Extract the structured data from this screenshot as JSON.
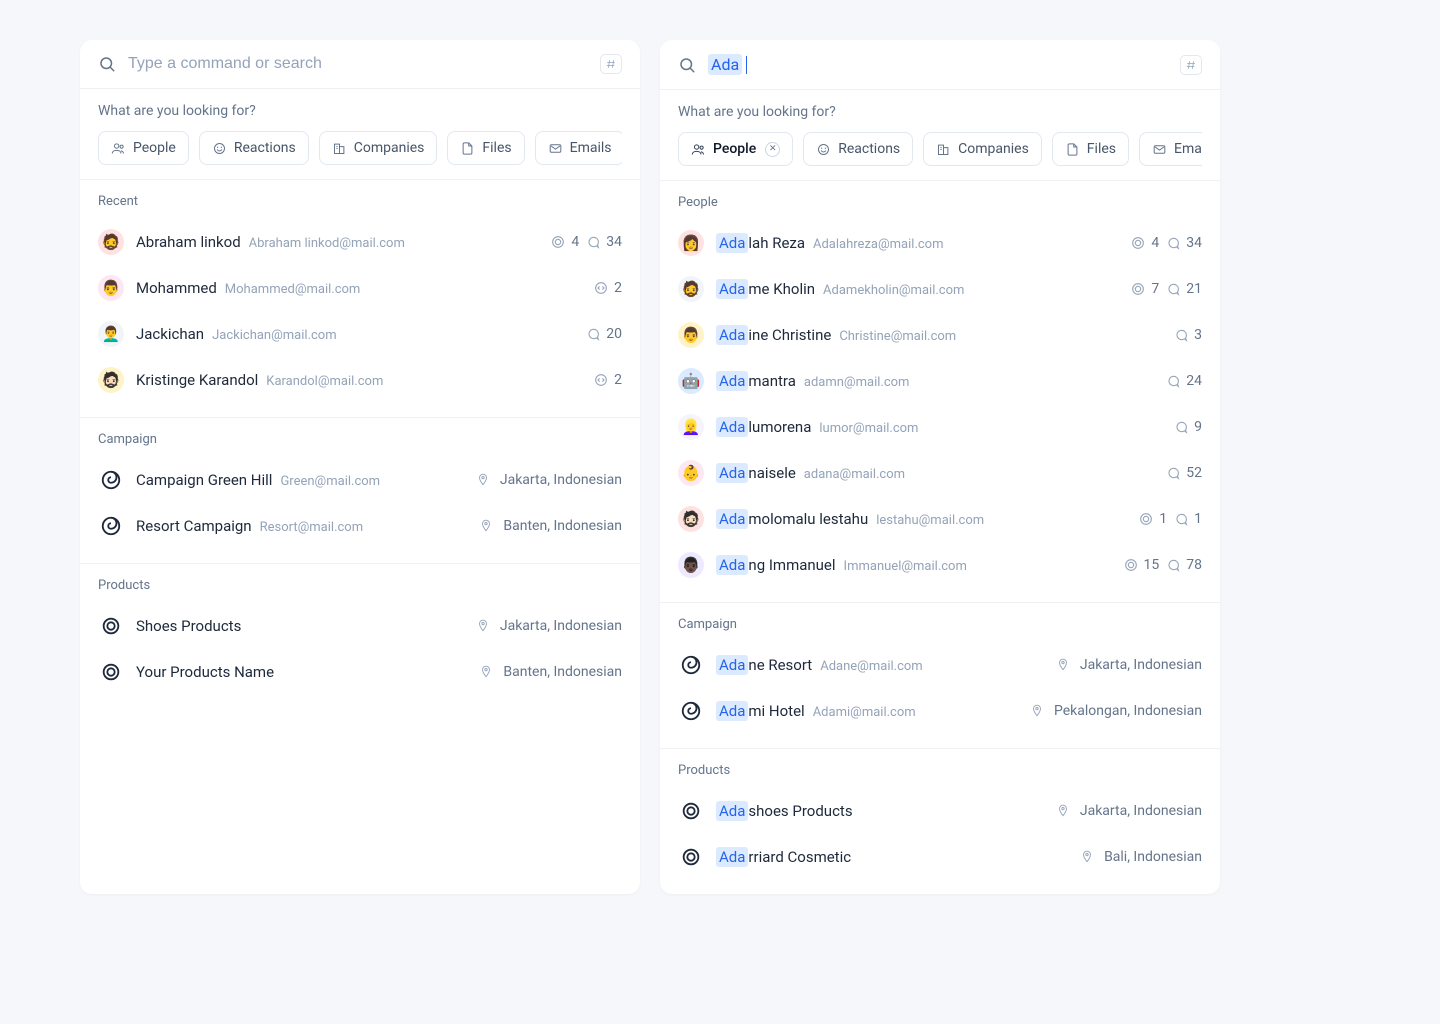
{
  "left": {
    "search": {
      "placeholder": "Type a command or search"
    },
    "filterLabel": "What are you looking for?",
    "chips": [
      {
        "label": "People",
        "icon": "people"
      },
      {
        "label": "Reactions",
        "icon": "reactions"
      },
      {
        "label": "Companies",
        "icon": "companies"
      },
      {
        "label": "Files",
        "icon": "files"
      },
      {
        "label": "Emails",
        "icon": "emails"
      }
    ],
    "sections": {
      "recent": {
        "title": "Recent",
        "rows": [
          {
            "name": "Abraham linkod",
            "email": "Abraham linkod@mail.com",
            "avatar": "🧔",
            "bg": "#FEE2E2",
            "stats": {
              "target": 4,
              "chat": 34
            }
          },
          {
            "name": "Mohammed",
            "email": "Mohammed@mail.com",
            "avatar": "👨",
            "bg": "#FCE7F3",
            "stats": {
              "code": 2
            }
          },
          {
            "name": "Jackichan",
            "email": "Jackichan@mail.com",
            "avatar": "👨‍🦱",
            "bg": "#F1F5F9",
            "stats": {
              "chat": 20
            }
          },
          {
            "name": "Kristinge Karandol",
            "email": "Karandol@mail.com",
            "avatar": "🧔🏻",
            "bg": "#FEF3C7",
            "stats": {
              "code": 2
            }
          }
        ]
      },
      "campaign": {
        "title": "Campaign",
        "rows": [
          {
            "name": "Campaign Green Hill",
            "email": "Green@mail.com",
            "location": "Jakarta, Indonesian"
          },
          {
            "name": "Resort Campaign",
            "email": "Resort@mail.com",
            "location": "Banten, Indonesian"
          }
        ]
      },
      "products": {
        "title": "Products",
        "rows": [
          {
            "name": "Shoes Products",
            "location": "Jakarta, Indonesian"
          },
          {
            "name": "Your Products Name",
            "location": "Banten, Indonesian"
          }
        ]
      }
    }
  },
  "right": {
    "search": {
      "query": "Ada"
    },
    "filterLabel": "What are you looking for?",
    "chips": [
      {
        "label": "People",
        "icon": "people",
        "active": true
      },
      {
        "label": "Reactions",
        "icon": "reactions"
      },
      {
        "label": "Companies",
        "icon": "companies"
      },
      {
        "label": "Files",
        "icon": "files"
      },
      {
        "label": "Emails",
        "icon": "emails"
      }
    ],
    "sections": {
      "people": {
        "title": "People",
        "rows": [
          {
            "hl": "Ada",
            "rest": "lah Reza",
            "email": "Adalahreza@mail.com",
            "avatar": "👩",
            "bg": "#FEE2E2",
            "stats": {
              "target": 4,
              "chat": 34
            }
          },
          {
            "hl": "Ada",
            "rest": "me Kholin",
            "email": "Adamekholin@mail.com",
            "avatar": "🧔",
            "bg": "#F1F5F9",
            "stats": {
              "target": 7,
              "chat": 21
            }
          },
          {
            "hl": "Ada",
            "rest": "ine Christine",
            "email": "Christine@mail.com",
            "avatar": "👨",
            "bg": "#FEF3C7",
            "stats": {
              "chat": 3
            }
          },
          {
            "hl": "Ada",
            "rest": "mantra",
            "email": "adamn@mail.com",
            "avatar": "🤖",
            "bg": "#DBEAFE",
            "stats": {
              "chat": 24
            }
          },
          {
            "hl": "Ada",
            "rest": "lumorena",
            "email": "lumor@mail.com",
            "avatar": "👱‍♀️",
            "bg": "#F5F3FF",
            "stats": {
              "chat": 9
            }
          },
          {
            "hl": "Ada",
            "rest": "naisele",
            "email": "adana@mail.com",
            "avatar": "👶",
            "bg": "#FCE7F3",
            "stats": {
              "chat": 52
            }
          },
          {
            "hl": "Ada",
            "rest": "molomalu lestahu",
            "email": "lestahu@mail.com",
            "avatar": "🧔🏻",
            "bg": "#FEE2E2",
            "stats": {
              "target": 1,
              "chat": 1
            }
          },
          {
            "hl": "Ada",
            "rest": "ng Immanuel",
            "email": "Immanuel@mail.com",
            "avatar": "👨🏿",
            "bg": "#EDE9FE",
            "stats": {
              "target": 15,
              "chat": 78
            }
          }
        ]
      },
      "campaign": {
        "title": "Campaign",
        "rows": [
          {
            "hl": "Ada",
            "rest": "ne Resort",
            "email": "Adane@mail.com",
            "location": "Jakarta, Indonesian"
          },
          {
            "hl": "Ada",
            "rest": "mi Hotel",
            "email": "Adami@mail.com",
            "location": "Pekalongan, Indonesian"
          }
        ]
      },
      "products": {
        "title": "Products",
        "rows": [
          {
            "hl": "Ada",
            "rest": "shoes Products",
            "location": "Jakarta, Indonesian"
          },
          {
            "hl": "Ada",
            "rest": "rriard Cosmetic",
            "location": "Bali, Indonesian"
          }
        ]
      }
    }
  }
}
